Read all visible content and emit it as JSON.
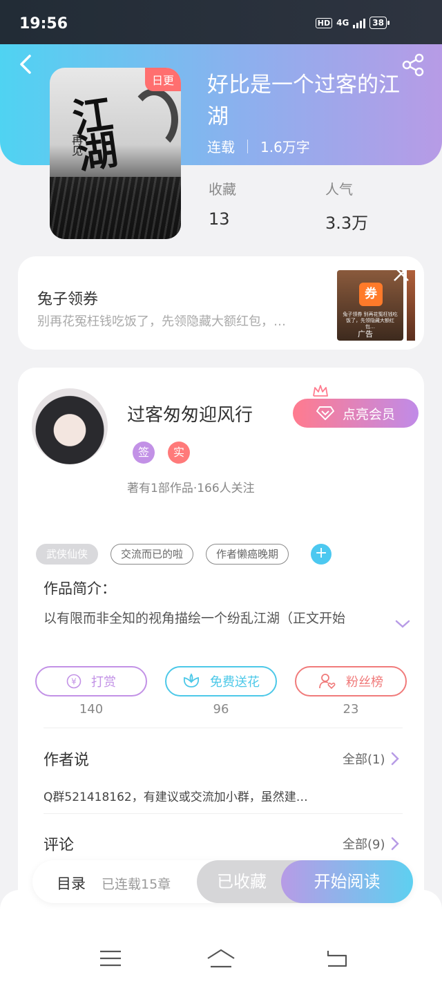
{
  "status_bar": {
    "time": "19:56",
    "hd": "HD",
    "network": "4G",
    "battery": "38"
  },
  "book": {
    "title": "好比是一个过客的江湖",
    "daily_badge": "日更",
    "cover_title": "江湖",
    "cover_author": "再见",
    "status": "连载",
    "word_count": "1.6万字",
    "stats": [
      {
        "label": "收藏",
        "value": "13"
      },
      {
        "label": "人气",
        "value": "3.3万"
      }
    ]
  },
  "ad": {
    "title": "兔子领券",
    "description": "别再花冤枉钱吃饭了，先领隐藏大额红包，…",
    "thumb_logo": "券",
    "thumb_text": "兔子领券 别再花冤枉钱吃饭了，先领隐藏大额红包…",
    "label": "广告"
  },
  "author": {
    "name": "过客匆匆迎风行",
    "vip_button": "点亮会员",
    "badge_sign": "签",
    "badge_real": "实",
    "stats": "著有1部作品·166人关注"
  },
  "tags": [
    "武侠仙侠",
    "交流而已的啦",
    "作者懒癌晚期"
  ],
  "tag_add": "+",
  "intro": {
    "label": "作品简介：",
    "text": "以有限而非全知的视角描绘一个纷乱江湖（正文开始"
  },
  "actions": [
    {
      "label": "打赏",
      "count": "140",
      "color": "#c291e6"
    },
    {
      "label": "免费送花",
      "count": "96",
      "color": "#4cc8e8"
    },
    {
      "label": "粉丝榜",
      "count": "23",
      "color": "#f07a7a"
    }
  ],
  "author_says": {
    "title": "作者说",
    "more": "全部(1)",
    "text": "Q群521418162，有建议或交流加小群，虽然建…"
  },
  "comments": {
    "title": "评论",
    "more": "全部(9)"
  },
  "bottom_bar": {
    "toc": "目录",
    "progress": "已连载15章",
    "collected": "已收藏",
    "read": "开始阅读"
  },
  "colors": {
    "accent_purple": "#c291e6",
    "accent_cyan": "#4cc8f0",
    "accent_red": "#f07a7a"
  }
}
